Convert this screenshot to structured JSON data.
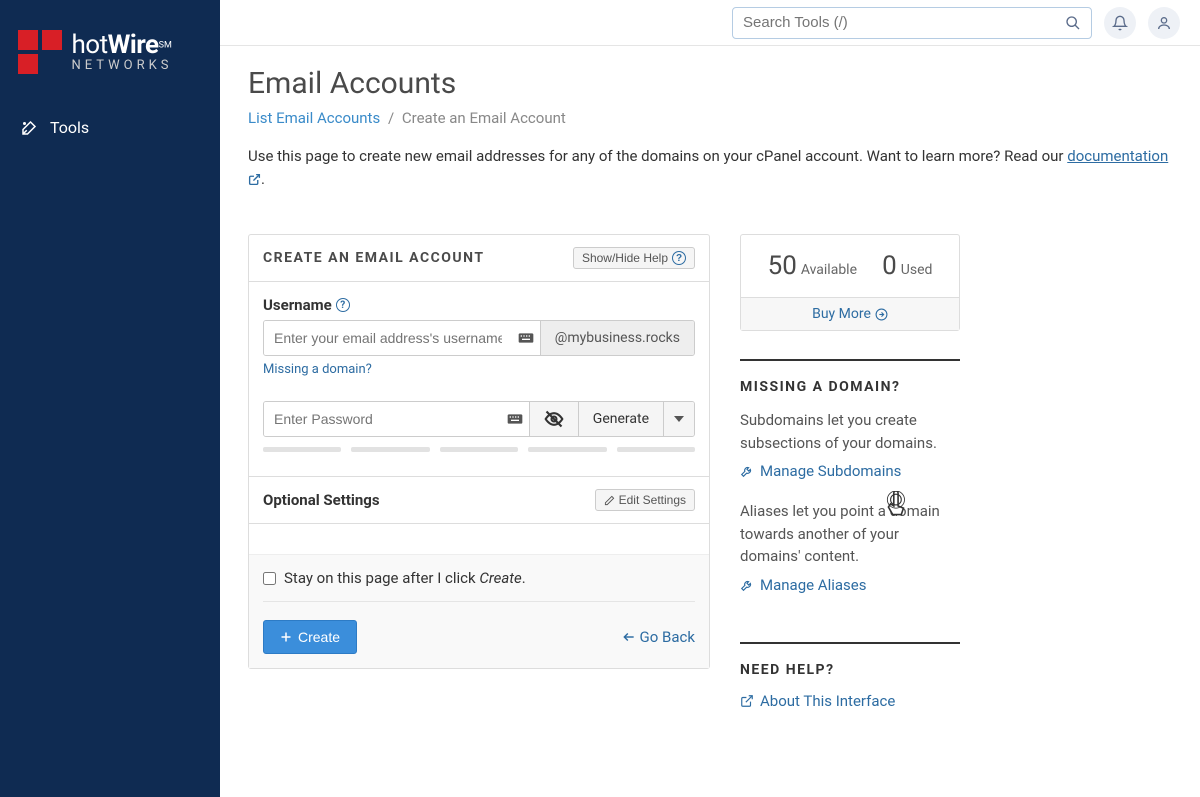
{
  "brand": {
    "hot": "hot",
    "wire": "Wire",
    "sm": "SM",
    "networks": "NETWORKS"
  },
  "sidebar": {
    "tools_label": "Tools"
  },
  "search": {
    "placeholder": "Search Tools (/)"
  },
  "page": {
    "title": "Email Accounts",
    "bc_list": "List Email Accounts",
    "bc_sep": "/",
    "bc_current": "Create an Email Account",
    "intro_text": "Use this page to create new email addresses for any of the domains on your cPanel account. Want to learn more? Read our ",
    "doc_link": "documentation",
    "intro_end": "."
  },
  "form": {
    "panel_title": "CREATE AN EMAIL ACCOUNT",
    "show_hide": "Show/Hide Help",
    "username_label": "Username",
    "username_placeholder": "Enter your email address's username",
    "domain": "@mybusiness.rocks",
    "missing_domain": "Missing a domain?",
    "password_placeholder": "Enter Password",
    "generate": "Generate",
    "optional_title": "Optional Settings",
    "edit_settings": "Edit Settings",
    "stay_label_pre": "Stay on this page after I click ",
    "stay_label_em": "Create",
    "stay_label_post": ".",
    "create_btn": "Create",
    "go_back": "Go Back"
  },
  "stats": {
    "available_num": "50",
    "available_label": "Available",
    "used_num": "0",
    "used_label": "Used",
    "buy_more": "Buy More"
  },
  "missing": {
    "title": "MISSING A DOMAIN?",
    "sub_text": "Subdomains let you create subsections of your domains.",
    "manage_sub": "Manage Subdomains",
    "alias_text": "Aliases let you point a domain towards another of your domains' content.",
    "manage_alias": "Manage Aliases"
  },
  "help": {
    "title": "NEED HELP?",
    "about": "About This Interface"
  }
}
